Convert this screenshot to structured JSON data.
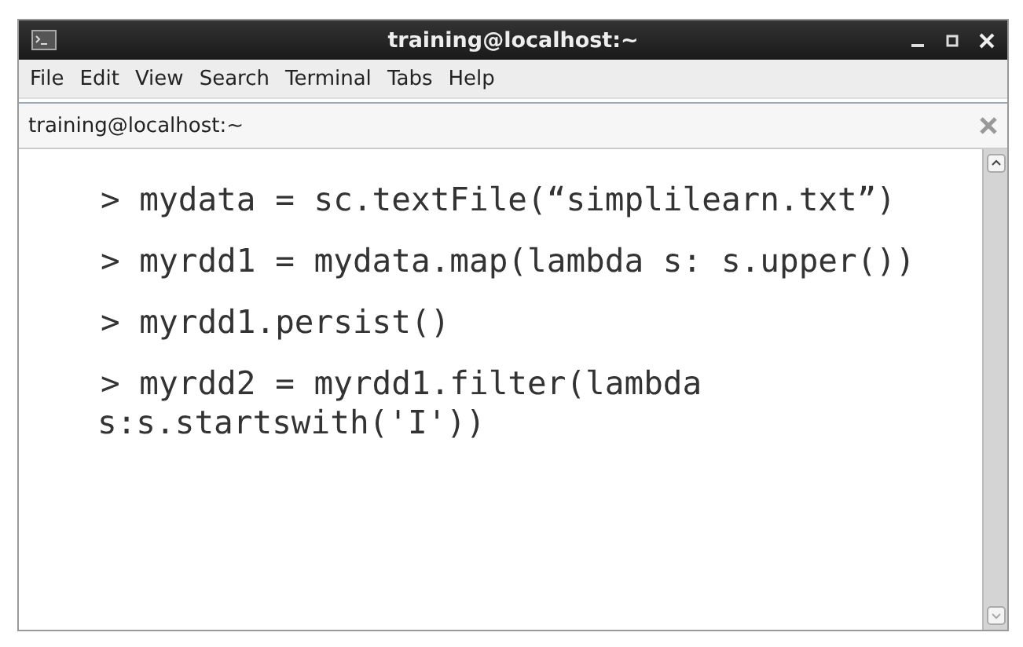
{
  "window": {
    "title": "training@localhost:~"
  },
  "menu": [
    "File",
    "Edit",
    "View",
    "Search",
    "Terminal",
    "Tabs",
    "Help"
  ],
  "tab": {
    "title": "training@localhost:~"
  },
  "terminal": {
    "lines": [
      {
        "kind": "command",
        "prompt": ">",
        "text": "mydata = sc.textFile(“simplilearn.txt”)"
      },
      {
        "kind": "command",
        "prompt": ">",
        "text": "myrdd1 = mydata.map(lambda s: s.upper())"
      },
      {
        "kind": "command",
        "prompt": ">",
        "text": "myrdd1.persist()"
      },
      {
        "kind": "command",
        "prompt": ">",
        "text": "myrdd2 = myrdd1.filter(lambda"
      },
      {
        "kind": "continuation",
        "text": "s:s.startswith('I'))"
      }
    ]
  }
}
